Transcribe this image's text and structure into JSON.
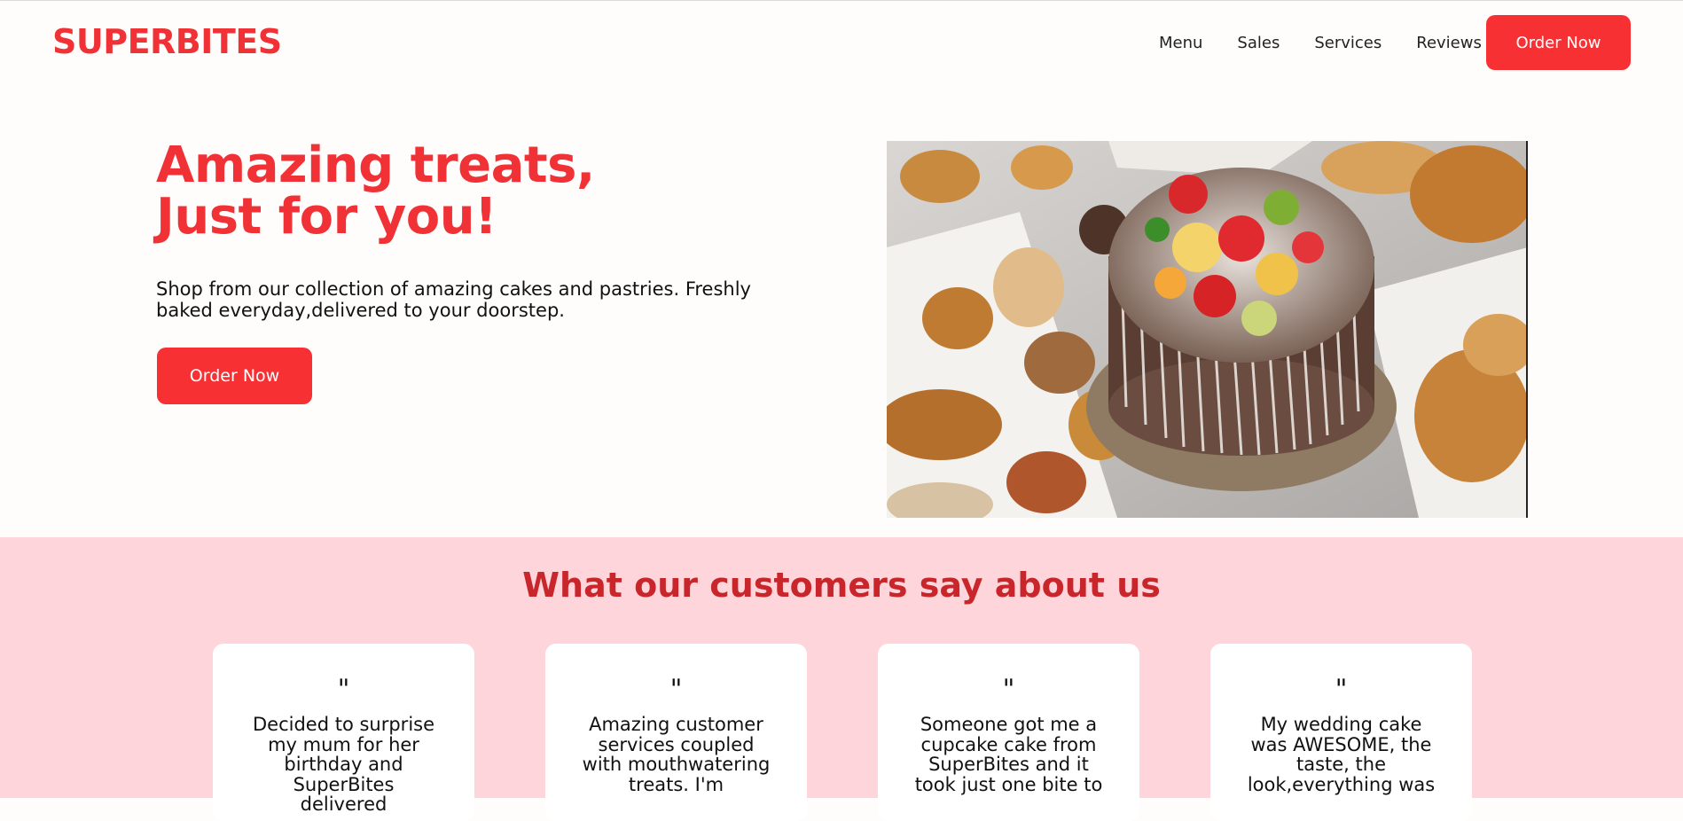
{
  "header": {
    "logo": "SUPERBITES",
    "nav": [
      "Menu",
      "Sales",
      "Services",
      "Reviews"
    ],
    "order_button": "Order Now"
  },
  "hero": {
    "title_line1": "Amazing treats,",
    "title_line2": "Just for you!",
    "description": "Shop from our collection of amazing cakes and pastries. Freshly baked everyday,delivered to your doorstep.",
    "order_button": "Order Now"
  },
  "reviews": {
    "title": "What our customers say about us",
    "quote_mark": "\"",
    "cards": [
      {
        "text": "Decided to surprise my mum for her birthday and SuperBites delivered"
      },
      {
        "text": "Amazing customer services coupled with mouthwatering treats. I'm"
      },
      {
        "text": "Someone got me a cupcake cake from SuperBites and it took just one bite to"
      },
      {
        "text": "My wedding cake was AWESOME, the taste, the look,everything was"
      }
    ]
  },
  "colors": {
    "brand_red": "#f03236",
    "button_red": "#f73034",
    "reviews_bg": "#fdd5da",
    "reviews_title": "#c8262b"
  }
}
